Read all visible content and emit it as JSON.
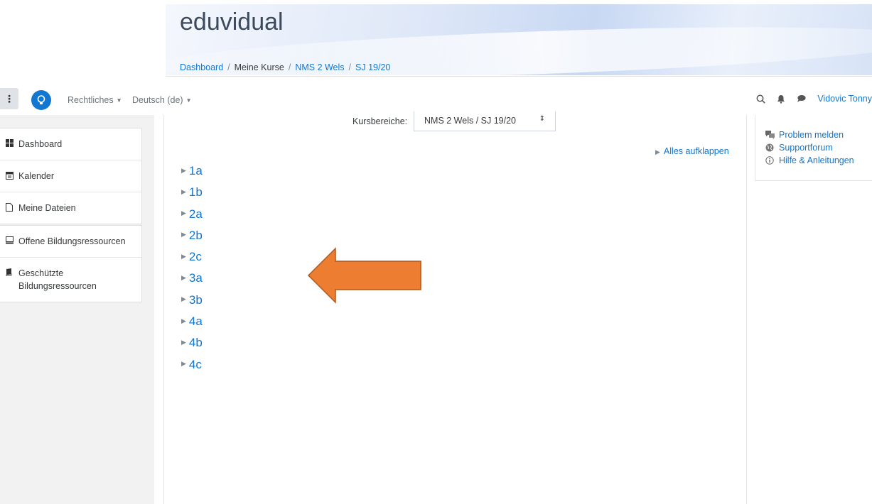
{
  "site": {
    "title": "eduvidual"
  },
  "breadcrumb": {
    "items": [
      "Dashboard",
      "Meine Kurse",
      "NMS 2 Wels",
      "SJ 19/20"
    ],
    "separator": "/"
  },
  "navbar": {
    "menu_legal": "Rechtliches",
    "menu_language": "Deutsch (de)",
    "user_name": "Vidovic Tonny"
  },
  "sidebar": {
    "items": [
      "Dashboard",
      "Kalender",
      "Meine Dateien"
    ],
    "resources": [
      "Offene Bildungsressourcen",
      "Geschützte Bildungsressourcen"
    ]
  },
  "main": {
    "category_label": "Kursbereiche:",
    "category_selected": "NMS 2 Wels / SJ 19/20",
    "expand_all": "Alles aufklappen",
    "courses": [
      "1a",
      "1b",
      "2a",
      "2b",
      "2c",
      "3a",
      "3b",
      "4a",
      "4b",
      "4c"
    ]
  },
  "help": {
    "items": [
      "Problem melden",
      "Supportforum",
      "Hilfe & Anleitungen"
    ]
  },
  "colors": {
    "link": "#1177d1",
    "arrow_fill": "#ed7d31",
    "arrow_stroke": "#ae5a21",
    "sidebar_bg": "#f2f2f2"
  }
}
